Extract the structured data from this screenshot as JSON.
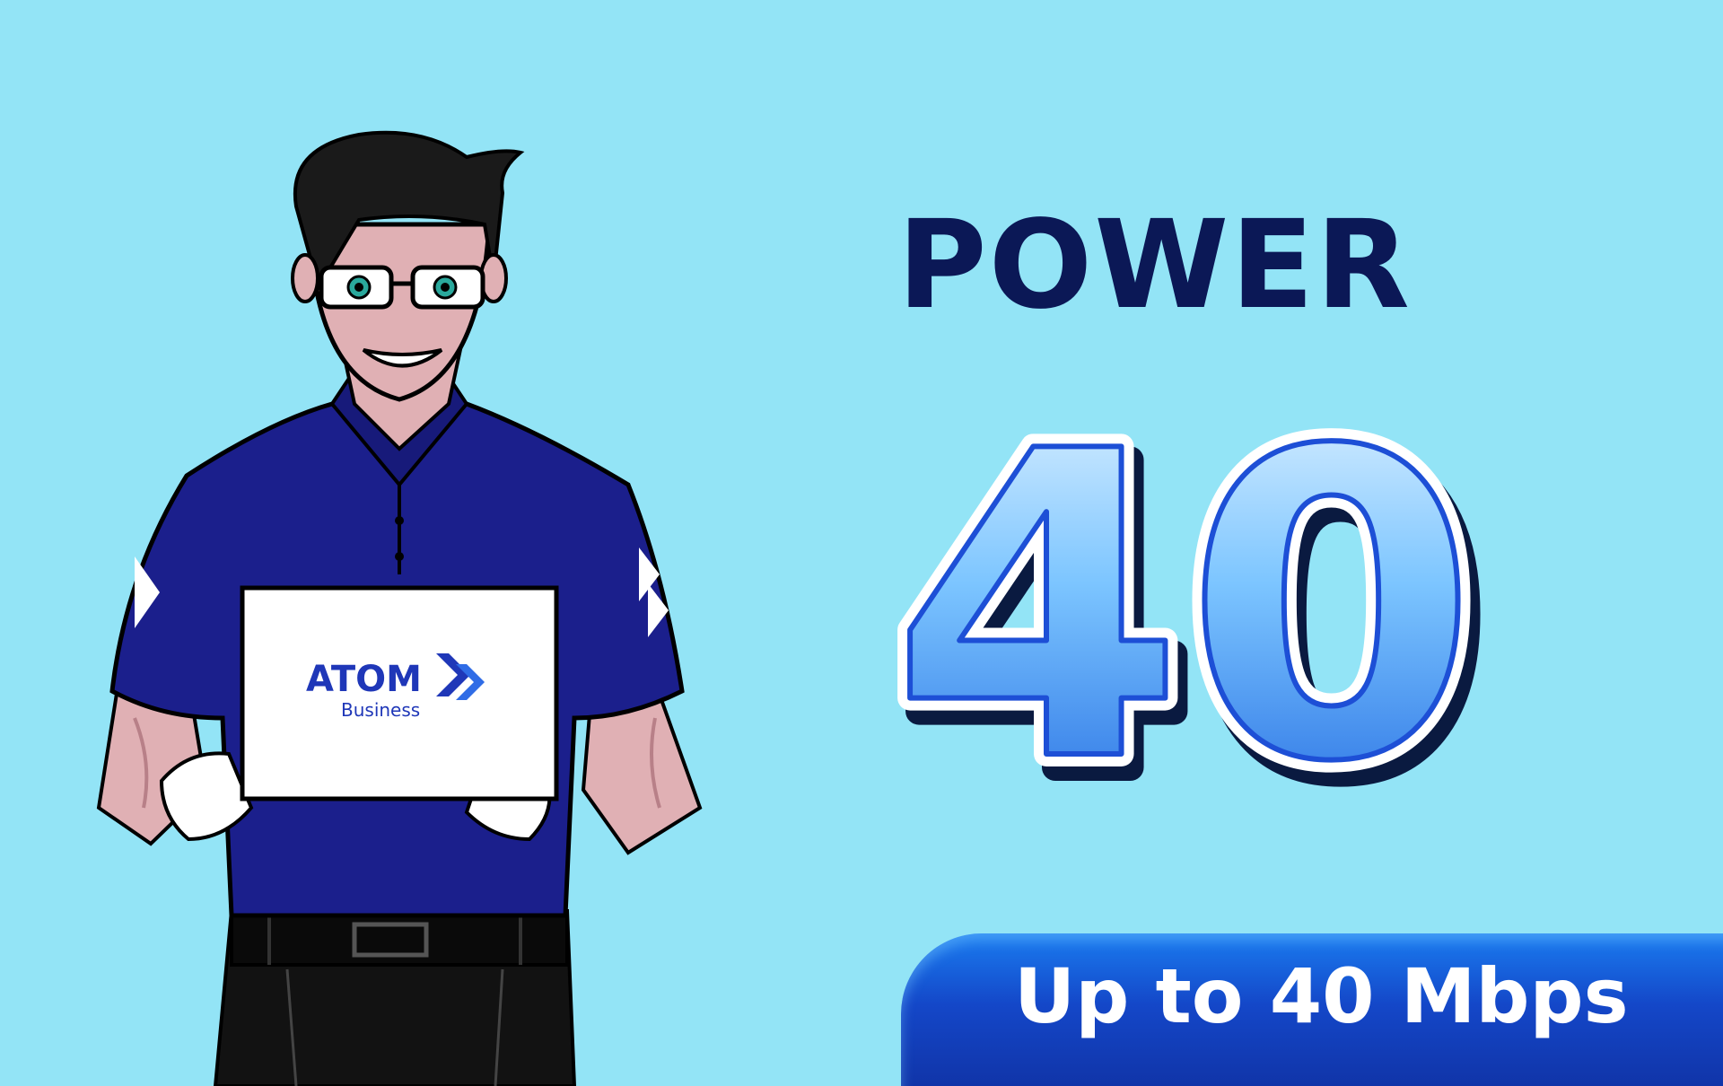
{
  "headline": "POWER",
  "big_number": "40",
  "speed_label": "Up to 40 Mbps",
  "brand": {
    "name": "ATOM",
    "tagline": "Business"
  },
  "colors": {
    "background": "#93e4f6",
    "headline": "#0b1856",
    "banner": "#1447c8",
    "shirt": "#1b1f8c",
    "brand": "#1f37b8"
  }
}
